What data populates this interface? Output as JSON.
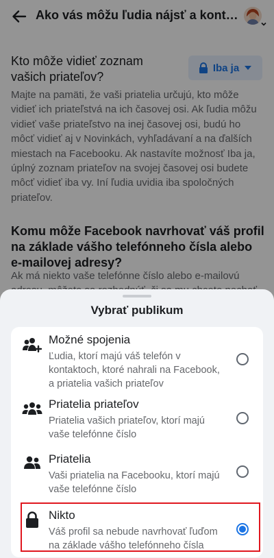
{
  "header": {
    "title": "Ako vás môžu ľudia nájsť a kontaktovať"
  },
  "sections": [
    {
      "title": "Kto môže vidieť zoznam vašich priateľov?",
      "audience_label": "Iba ja",
      "description": "Majte na pamäti, že vaši priatelia určujú, kto môže vidieť ich priateľstvá na ich časovej osi. Ak ľudia môžu vidieť vaše priateľstvo na inej časovej osi, budú ho môcť vidieť aj v Novinkách, vyhľadávaní a na ďalších miestach na Facebooku. Ak nastavíte možnosť Iba ja, úplný zoznam priateľov na svojej časovej osi budete môcť vidieť iba vy. Iní ľudia uvidia iba spoločných priateľov."
    },
    {
      "title": "Komu môže Facebook navrhovať váš profil na základe vášho telefónneho čísla alebo e-mailovej adresy?",
      "description": "Ak má niekto vaše telefónne číslo alebo e-mailovú adresu, môžete sa rozhodnúť, či sa mu chcete nechať navrhovať."
    }
  ],
  "sheet": {
    "title": "Vybrať publikum",
    "options": [
      {
        "title": "Možné spojenia",
        "description": "Ľudia, ktorí majú váš telefón v kontaktoch, ktoré nahrali na Facebook, a priatelia vašich priateľov",
        "icon": "people-plus-icon",
        "selected": false
      },
      {
        "title": "Priatelia priateľov",
        "description": "Priatelia vašich priateľov, ktorí majú vaše telefónne číslo",
        "icon": "friends-of-friends-icon",
        "selected": false
      },
      {
        "title": "Priatelia",
        "description": "Vaši priatelia na Facebooku, ktorí majú vaše telefónne číslo",
        "icon": "friends-icon",
        "selected": false
      },
      {
        "title": "Nikto",
        "description": "Váš profil sa nebude navrhovať ľuďom na základe vášho telefónneho čísla",
        "icon": "lock-icon",
        "selected": true
      }
    ]
  },
  "colors": {
    "accent": "#1b74e4",
    "highlight_border": "#e0161e",
    "secondary_text": "#65676b",
    "sheet_background": "#f0f2f5"
  }
}
